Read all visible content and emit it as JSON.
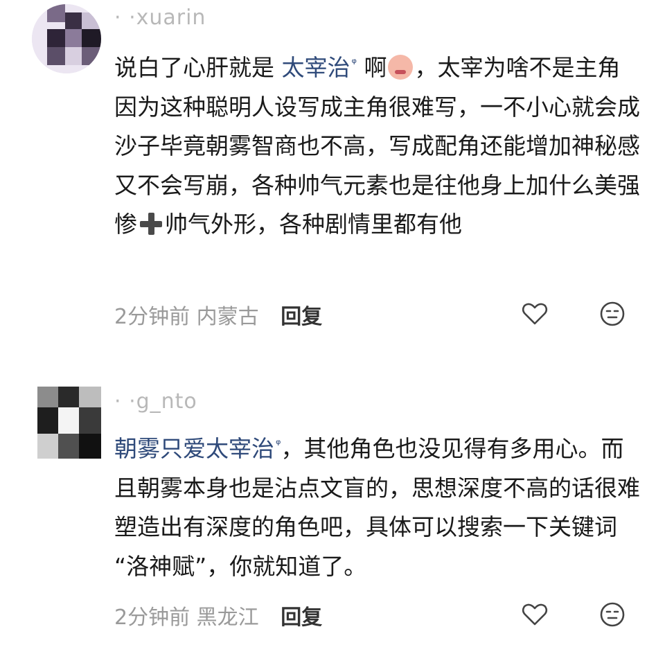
{
  "comments": [
    {
      "username": "· ·xuarin",
      "link_text": "太宰治",
      "text_before_link": "说白了心肝就是 ",
      "text_after_link": "啊",
      "text_rest": "，太宰为啥不是主角因为这种聪明人设写成主角很难写，一不小心就会成沙子毕竟朝雾智商也不高，写成配角还能增加神秘感又不会写崩，各种帅气元素也是往他身上加什么美强惨",
      "text_tail": "帅气外形，各种剧情里都有他",
      "time": "2分钟前",
      "location": "内蒙古",
      "reply_label": "回复",
      "icons": [
        "heart-icon",
        "neutral-face-icon"
      ]
    },
    {
      "username": "· ·g_nto",
      "link_text": "朝雾只爱太宰治",
      "text_rest": "，其他角色也没见得有多用心。而且朝雾本身也是沾点文盲的，思想深度不高的话很难塑造出有深度的角色吧，具体可以搜索一下关键词 “洛神赋”，你就知道了。",
      "time": "2分钟前",
      "location": "黑龙江",
      "reply_label": "回复",
      "icons": [
        "heart-icon",
        "neutral-face-icon"
      ]
    }
  ]
}
